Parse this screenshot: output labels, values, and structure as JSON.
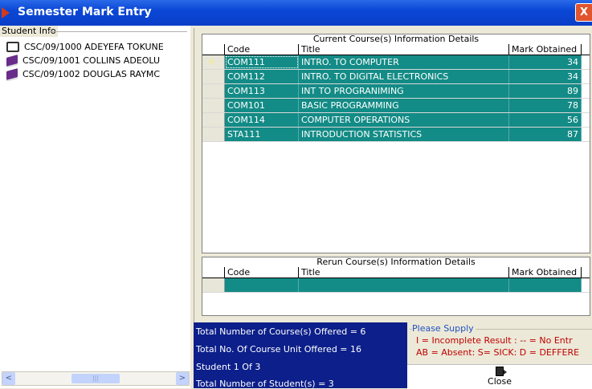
{
  "window": {
    "title": "Semester Mark Entry",
    "close_glyph": "X"
  },
  "student_info": {
    "legend": "Student Info",
    "students": [
      {
        "label": "CSC/09/1000  ADEYEFA  TOKUNE",
        "icon": "open-book-icon"
      },
      {
        "label": "CSC/09/1001  COLLINS  ADEOLU",
        "icon": "closed-book-icon"
      },
      {
        "label": "CSC/09/1002  DOUGLAS  RAYMC",
        "icon": "closed-book-icon"
      }
    ],
    "scroll": {
      "left": "<",
      "right": ">",
      "thumb": "|||"
    }
  },
  "current_courses": {
    "caption": "Current Course(s)  Information Details",
    "headers": {
      "code": "Code",
      "title": "Title",
      "mark": "Mark Obtained"
    },
    "rows": [
      {
        "code": "COM111",
        "title": "INTRO. TO COMPUTER",
        "mark": "34"
      },
      {
        "code": "COM112",
        "title": "INTRO. TO DIGITAL  ELECTRONICS",
        "mark": "34"
      },
      {
        "code": "COM113",
        "title": "INT TO PROGRANIMING",
        "mark": "89"
      },
      {
        "code": "COM101",
        "title": "BASIC PROGRAMMING",
        "mark": "78"
      },
      {
        "code": "COM114",
        "title": "COMPUTER OPERATIONS",
        "mark": "56"
      },
      {
        "code": "STA111",
        "title": "INTRODUCTION  STATISTICS",
        "mark": "87"
      }
    ]
  },
  "rerun_courses": {
    "caption": "Rerun Course(s) Information Details",
    "headers": {
      "code": "Code",
      "title": "Title",
      "mark": "Mark Obtained"
    }
  },
  "summary": {
    "courses_offered": "Total Number of Course(s) Offered  = 6",
    "units_offered": "Total No. Of Course Unit Offered = 16",
    "student_pos": "Student 1 Of 3",
    "total_students": "Total Number of Student(s)  = 3"
  },
  "supply": {
    "legend": "Please Supply",
    "line1": "I = Incomplete Result  : --  = No Entr",
    "line2": "AB = Absent: S= SICK: D = DEFFERE"
  },
  "close_button": {
    "label": "Close"
  }
}
